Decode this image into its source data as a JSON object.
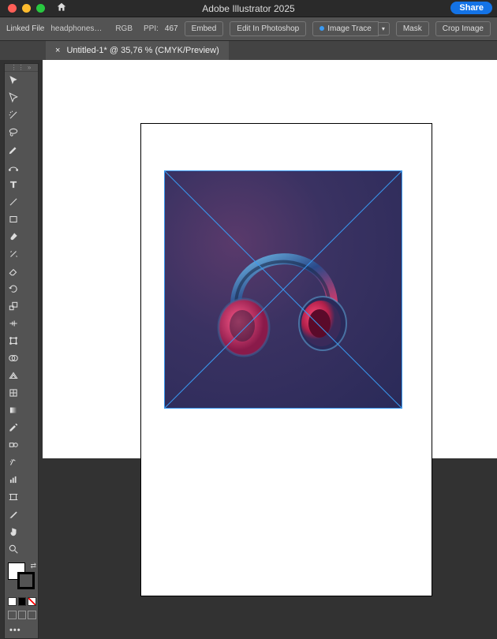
{
  "titlebar": {
    "app_title": "Adobe Illustrator 2025",
    "share_label": "Share"
  },
  "options": {
    "linked_label": "Linked File",
    "filename": "headphones-or-headset-in...",
    "color_mode": "RGB",
    "ppi_label": "PPI:",
    "ppi_value": "467",
    "embed": "Embed",
    "edit_ps": "Edit In Photoshop",
    "image_trace": "Image Trace",
    "mask": "Mask",
    "crop": "Crop Image"
  },
  "tab": {
    "label": "Untitled-1* @ 35,76 % (CMYK/Preview)"
  },
  "tools": {
    "names": [
      "selection-tool",
      "direct-selection-tool",
      "magic-wand-tool",
      "lasso-tool",
      "pen-tool",
      "curvature-tool",
      "type-tool",
      "line-segment-tool",
      "rectangle-tool",
      "paintbrush-tool",
      "shaper-tool",
      "eraser-tool",
      "rotate-tool",
      "scale-tool",
      "width-tool",
      "free-transform-tool",
      "shape-builder-tool",
      "perspective-grid-tool",
      "mesh-tool",
      "gradient-tool",
      "eyedropper-tool",
      "blend-tool",
      "symbol-sprayer-tool",
      "column-graph-tool",
      "artboard-tool",
      "slice-tool",
      "hand-tool",
      "zoom-tool"
    ]
  }
}
